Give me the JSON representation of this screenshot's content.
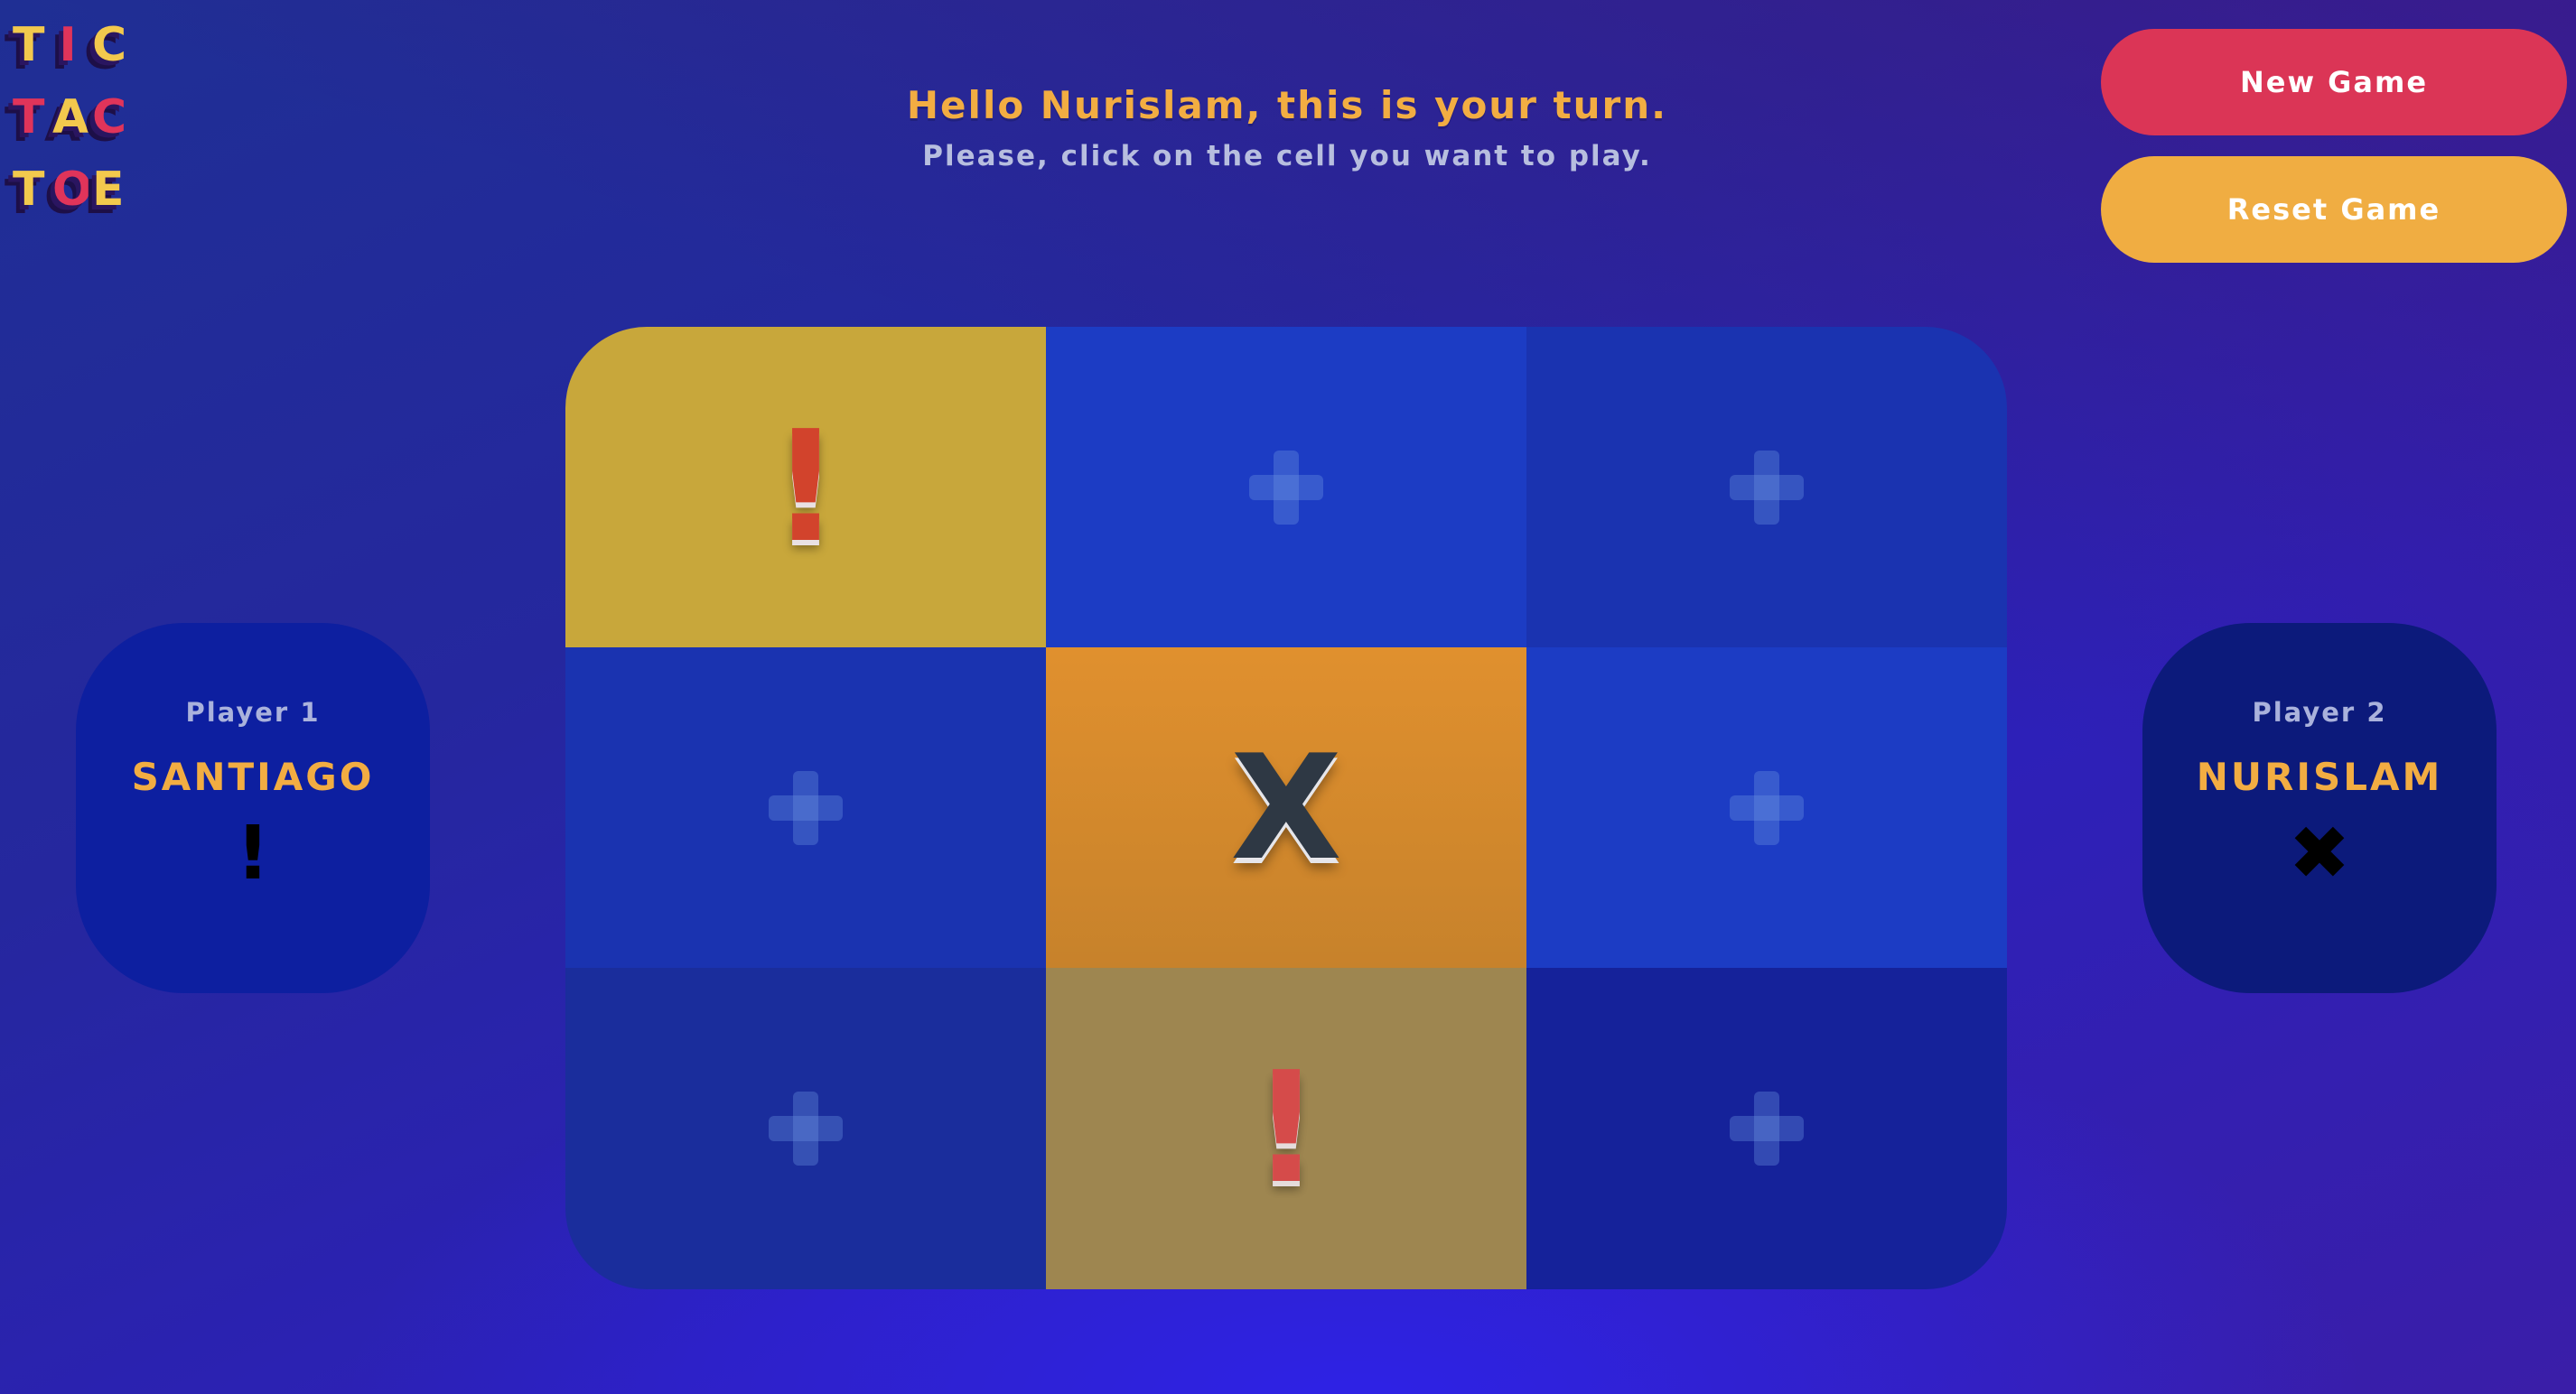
{
  "logo": {
    "rows": [
      [
        "T",
        "I",
        "C"
      ],
      [
        "T",
        "A",
        "C"
      ],
      [
        "T",
        "O",
        "E"
      ]
    ]
  },
  "message": {
    "title": "Hello Nurislam, this is your turn.",
    "subtitle": "Please, click on the cell you want to play."
  },
  "buttons": {
    "new_game": "New Game",
    "reset_game": "Reset Game"
  },
  "players": [
    {
      "label": "Player 1",
      "name": "SANTIAGO",
      "symbol": "!"
    },
    {
      "label": "Player 2",
      "name": "NURISLAM",
      "symbol": "✖"
    }
  ],
  "board": {
    "cells": [
      "!",
      "",
      "",
      "",
      "X",
      "",
      "",
      "!",
      ""
    ],
    "empty_cell_icon": "plus-icon"
  },
  "colors": {
    "accent_orange": "#f2ad42",
    "new_game_red": "#db3556",
    "reset_game_orange": "#f0ad42",
    "logo_yellow": "#f3c94d",
    "logo_red": "#e0345a"
  }
}
